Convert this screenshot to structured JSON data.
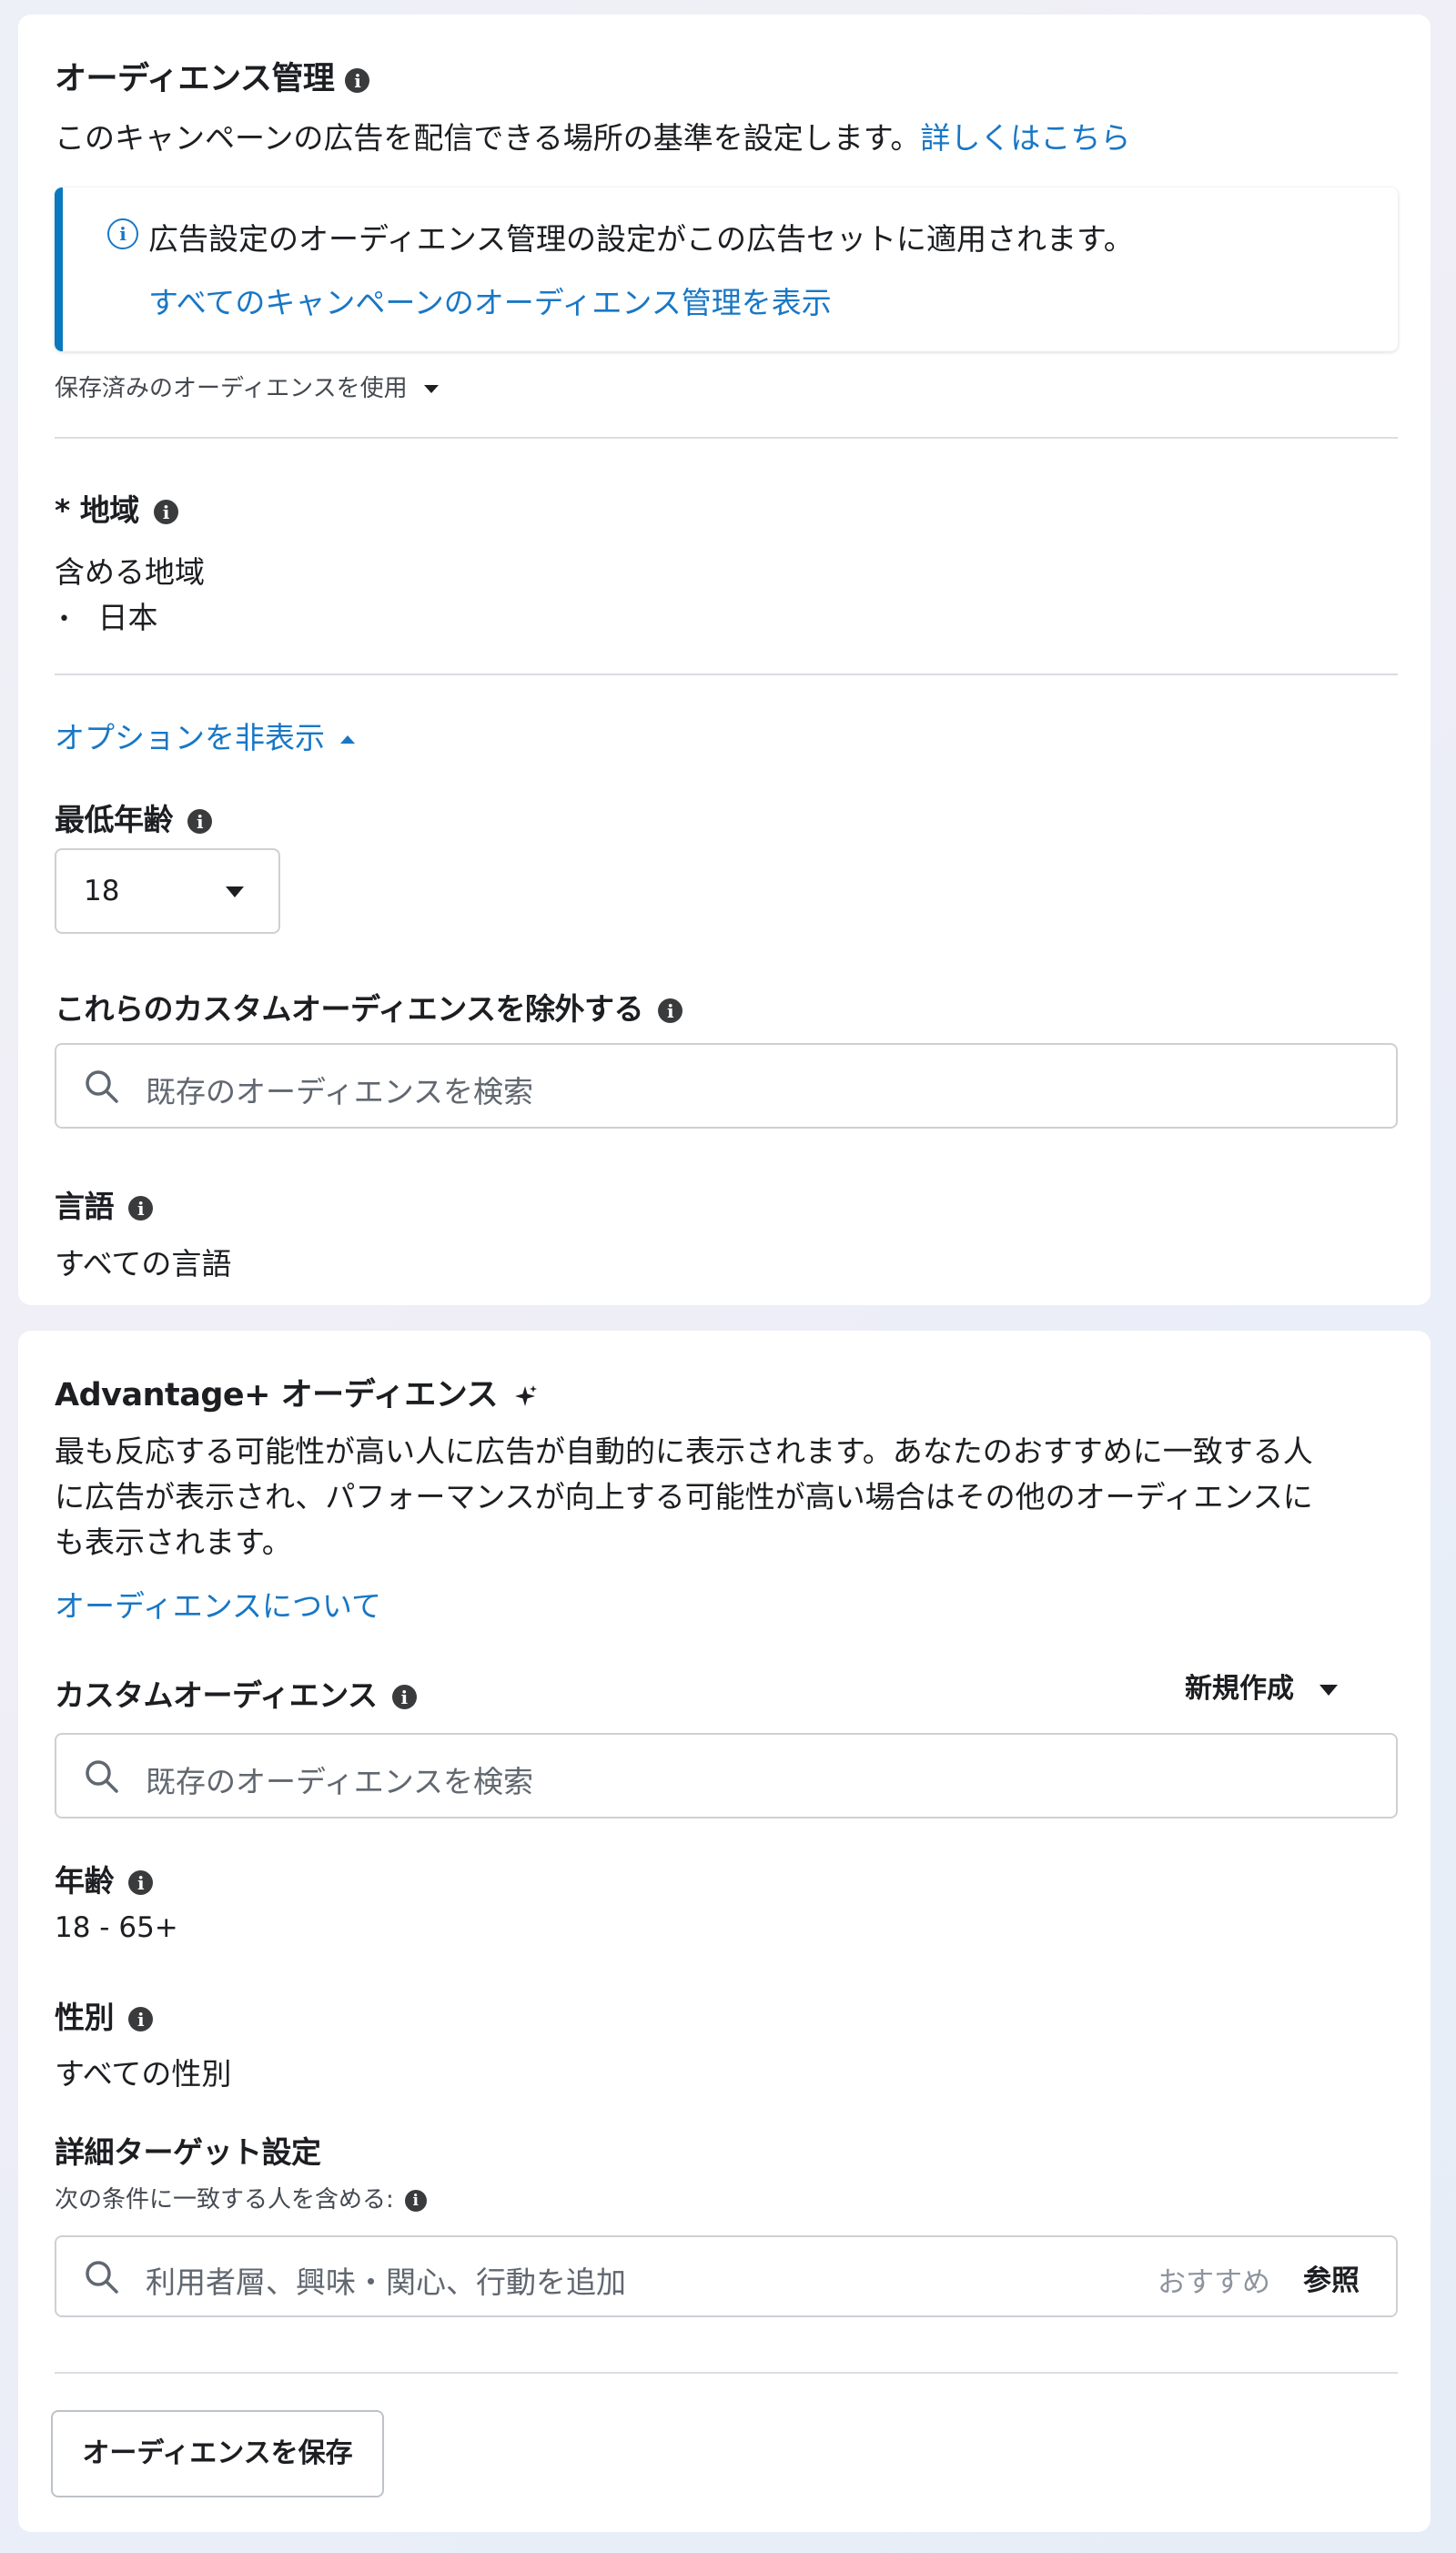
{
  "audience_control": {
    "title": "オーディエンス管理",
    "description": "このキャンペーンの広告を配信できる場所の基準を設定します。",
    "learn_more": "詳しくはこちら",
    "notice": {
      "text": "広告設定のオーディエンス管理の設定がこの広告セットに適用されます。",
      "link": "すべてのキャンペーンのオーディエンス管理を表示"
    },
    "saved_audience": "保存済みのオーディエンスを使用",
    "location": {
      "label": "* 地域",
      "included_label": "含める地域",
      "items": [
        "日本"
      ]
    },
    "hide_options": "オプションを非表示",
    "min_age": {
      "label": "最低年齢",
      "value": "18"
    },
    "exclude_custom": {
      "label": "これらのカスタムオーディエンスを除外する",
      "placeholder": "既存のオーディエンスを検索"
    },
    "language": {
      "label": "言語",
      "value": "すべての言語"
    }
  },
  "advantage": {
    "title": "Advantage+ オーディエンス",
    "description_lines": [
      "最も反応する可能性が高い人に広告が自動的に表示されます。あなたのおすすめに一致する人",
      "に広告が表示され、パフォーマンスが向上する可能性が高い場合はその他のオーディエンスに",
      "も表示されます。"
    ],
    "about_link": "オーディエンスについて",
    "custom_audience": {
      "label": "カスタムオーディエンス",
      "create_new": "新規作成",
      "placeholder": "既存のオーディエンスを検索"
    },
    "age": {
      "label": "年齢",
      "value": "18 - 65+"
    },
    "gender": {
      "label": "性別",
      "value": "すべての性別"
    },
    "detailed_targeting": {
      "label": "詳細ターゲット設定",
      "sublabel": "次の条件に一致する人を含める:",
      "placeholder": "利用者層、興味・関心、行動を追加",
      "suggest": "おすすめ",
      "browse": "参照"
    },
    "save_button": "オーディエンスを保存"
  }
}
